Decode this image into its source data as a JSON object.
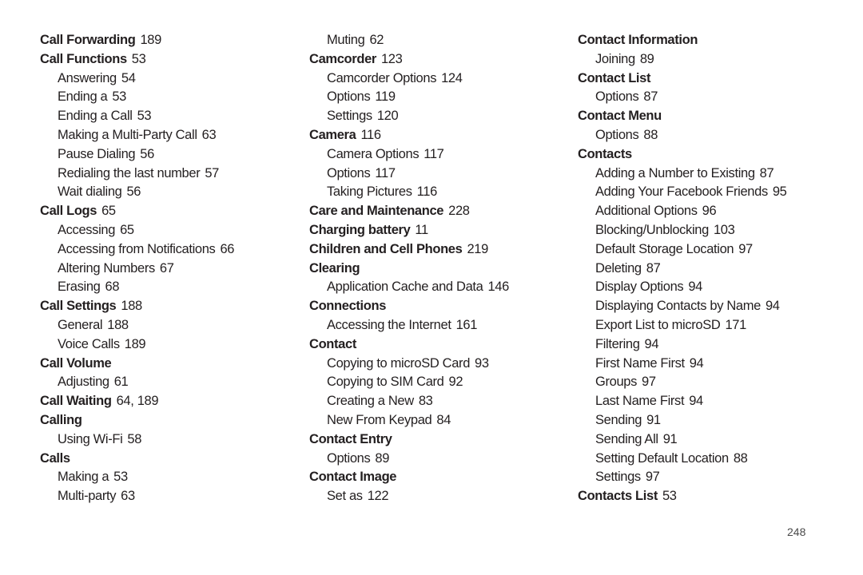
{
  "columns": [
    {
      "entries": [
        {
          "level": "main",
          "term": "Call Forwarding",
          "pages": "189"
        },
        {
          "level": "main",
          "term": "Call Functions",
          "pages": "53"
        },
        {
          "level": "sub",
          "term": "Answering",
          "pages": "54"
        },
        {
          "level": "sub",
          "term": "Ending a",
          "pages": "53"
        },
        {
          "level": "sub",
          "term": "Ending a Call",
          "pages": "53"
        },
        {
          "level": "sub",
          "term": "Making a Multi-Party Call",
          "pages": "63"
        },
        {
          "level": "sub",
          "term": "Pause Dialing",
          "pages": "56"
        },
        {
          "level": "sub",
          "term": "Redialing the last number",
          "pages": "57"
        },
        {
          "level": "sub",
          "term": "Wait dialing",
          "pages": "56"
        },
        {
          "level": "main",
          "term": "Call Logs",
          "pages": "65"
        },
        {
          "level": "sub",
          "term": "Accessing",
          "pages": "65"
        },
        {
          "level": "sub",
          "term": "Accessing from Notifications",
          "pages": "66"
        },
        {
          "level": "sub",
          "term": "Altering Numbers",
          "pages": "67"
        },
        {
          "level": "sub",
          "term": "Erasing",
          "pages": "68"
        },
        {
          "level": "main",
          "term": "Call Settings",
          "pages": "188"
        },
        {
          "level": "sub",
          "term": "General",
          "pages": "188"
        },
        {
          "level": "sub",
          "term": "Voice Calls",
          "pages": "189"
        },
        {
          "level": "main",
          "term": "Call Volume",
          "pages": ""
        },
        {
          "level": "sub",
          "term": "Adjusting",
          "pages": "61"
        },
        {
          "level": "main",
          "term": "Call Waiting",
          "pages": "64, 189"
        },
        {
          "level": "main",
          "term": "Calling",
          "pages": ""
        },
        {
          "level": "sub",
          "term": "Using Wi-Fi",
          "pages": "58"
        },
        {
          "level": "main",
          "term": "Calls",
          "pages": ""
        },
        {
          "level": "sub",
          "term": "Making a",
          "pages": "53"
        },
        {
          "level": "sub",
          "term": "Multi-party",
          "pages": "63"
        }
      ]
    },
    {
      "entries": [
        {
          "level": "sub",
          "term": "Muting",
          "pages": "62"
        },
        {
          "level": "main",
          "term": "Camcorder",
          "pages": "123"
        },
        {
          "level": "sub",
          "term": "Camcorder Options",
          "pages": "124"
        },
        {
          "level": "sub",
          "term": "Options",
          "pages": "119"
        },
        {
          "level": "sub",
          "term": "Settings",
          "pages": "120"
        },
        {
          "level": "main",
          "term": "Camera",
          "pages": "116"
        },
        {
          "level": "sub",
          "term": "Camera Options",
          "pages": "117"
        },
        {
          "level": "sub",
          "term": "Options",
          "pages": "117"
        },
        {
          "level": "sub",
          "term": "Taking Pictures",
          "pages": "116"
        },
        {
          "level": "main",
          "term": "Care and Maintenance",
          "pages": "228"
        },
        {
          "level": "main",
          "term": "Charging battery",
          "pages": "11"
        },
        {
          "level": "main",
          "term": "Children and Cell Phones",
          "pages": "219"
        },
        {
          "level": "main",
          "term": "Clearing",
          "pages": ""
        },
        {
          "level": "sub",
          "term": "Application Cache and Data",
          "pages": "146"
        },
        {
          "level": "main",
          "term": "Connections",
          "pages": ""
        },
        {
          "level": "sub",
          "term": "Accessing the Internet",
          "pages": "161"
        },
        {
          "level": "main",
          "term": "Contact",
          "pages": ""
        },
        {
          "level": "sub",
          "term": "Copying to microSD Card",
          "pages": "93"
        },
        {
          "level": "sub",
          "term": "Copying to SIM Card",
          "pages": "92"
        },
        {
          "level": "sub",
          "term": "Creating a New",
          "pages": "83"
        },
        {
          "level": "sub",
          "term": "New From Keypad",
          "pages": "84"
        },
        {
          "level": "main",
          "term": "Contact Entry",
          "pages": ""
        },
        {
          "level": "sub",
          "term": "Options",
          "pages": "89"
        },
        {
          "level": "main",
          "term": "Contact Image",
          "pages": ""
        },
        {
          "level": "sub",
          "term": "Set as",
          "pages": "122"
        }
      ]
    },
    {
      "entries": [
        {
          "level": "main",
          "term": "Contact Information",
          "pages": ""
        },
        {
          "level": "sub",
          "term": "Joining",
          "pages": "89"
        },
        {
          "level": "main",
          "term": "Contact List",
          "pages": ""
        },
        {
          "level": "sub",
          "term": "Options",
          "pages": "87"
        },
        {
          "level": "main",
          "term": "Contact Menu",
          "pages": ""
        },
        {
          "level": "sub",
          "term": "Options",
          "pages": "88"
        },
        {
          "level": "main",
          "term": "Contacts",
          "pages": ""
        },
        {
          "level": "sub",
          "term": "Adding a Number to Existing",
          "pages": "87"
        },
        {
          "level": "sub",
          "term": "Adding Your Facebook Friends",
          "pages": "95"
        },
        {
          "level": "sub",
          "term": "Additional Options",
          "pages": "96"
        },
        {
          "level": "sub",
          "term": "Blocking/Unblocking",
          "pages": "103"
        },
        {
          "level": "sub",
          "term": "Default Storage Location",
          "pages": "97"
        },
        {
          "level": "sub",
          "term": "Deleting",
          "pages": "87"
        },
        {
          "level": "sub",
          "term": "Display Options",
          "pages": "94"
        },
        {
          "level": "sub",
          "term": "Displaying Contacts by Name",
          "pages": "94"
        },
        {
          "level": "sub",
          "term": "Export List to microSD",
          "pages": "171"
        },
        {
          "level": "sub",
          "term": "Filtering",
          "pages": "94"
        },
        {
          "level": "sub",
          "term": "First Name First",
          "pages": "94"
        },
        {
          "level": "sub",
          "term": "Groups",
          "pages": "97"
        },
        {
          "level": "sub",
          "term": "Last Name First",
          "pages": "94"
        },
        {
          "level": "sub",
          "term": "Sending",
          "pages": "91"
        },
        {
          "level": "sub",
          "term": "Sending All",
          "pages": "91"
        },
        {
          "level": "sub",
          "term": "Setting Default Location",
          "pages": "88"
        },
        {
          "level": "sub",
          "term": "Settings",
          "pages": "97"
        },
        {
          "level": "main",
          "term": "Contacts List",
          "pages": "53"
        }
      ]
    }
  ],
  "footer": {
    "page_number": "248"
  }
}
